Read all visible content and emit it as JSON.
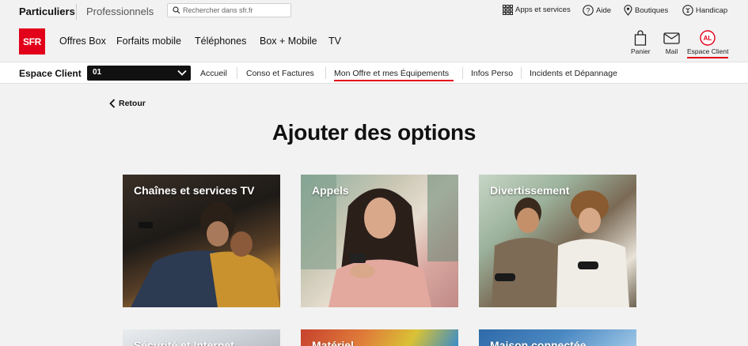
{
  "topbar": {
    "segment_particuliers": "Particuliers",
    "segment_professionnels": "Professionnels",
    "search_placeholder": "Rechercher dans sfr.fr",
    "apps_label": "Apps et services",
    "aide_label": "Aide",
    "boutiques_label": "Boutiques",
    "handicap_label": "Handicap"
  },
  "header": {
    "logo_text": "SFR",
    "nav": [
      "Offres Box",
      "Forfaits mobile",
      "Téléphones",
      "Box + Mobile",
      "TV"
    ],
    "panier_label": "Panier",
    "mail_label": "Mail",
    "espace_client_label": "Espace Client",
    "avatar_initials": "AL",
    "brand_color": "#e2001a"
  },
  "espace_client": {
    "title": "Espace Client",
    "line_selected": "01",
    "tabs": [
      "Accueil",
      "Conso et Factures",
      "Mon Offre et mes Équipements",
      "Infos Perso",
      "Incidents et Dépannage"
    ],
    "active_tab": "Mon Offre et mes Équipements"
  },
  "content": {
    "back_label": "Retour",
    "title": "Ajouter des options",
    "cards": [
      {
        "label": "Chaînes et services TV",
        "image": "couple-watching-tv"
      },
      {
        "label": "Appels",
        "image": "woman-with-phone"
      },
      {
        "label": "Divertissement",
        "image": "friends-gaming"
      },
      {
        "label": "Sécurité et Internet",
        "image": "home-interior"
      },
      {
        "label": "Matériel",
        "image": "colorful-cables"
      },
      {
        "label": "Maison connectée",
        "image": "connected-home"
      }
    ]
  }
}
